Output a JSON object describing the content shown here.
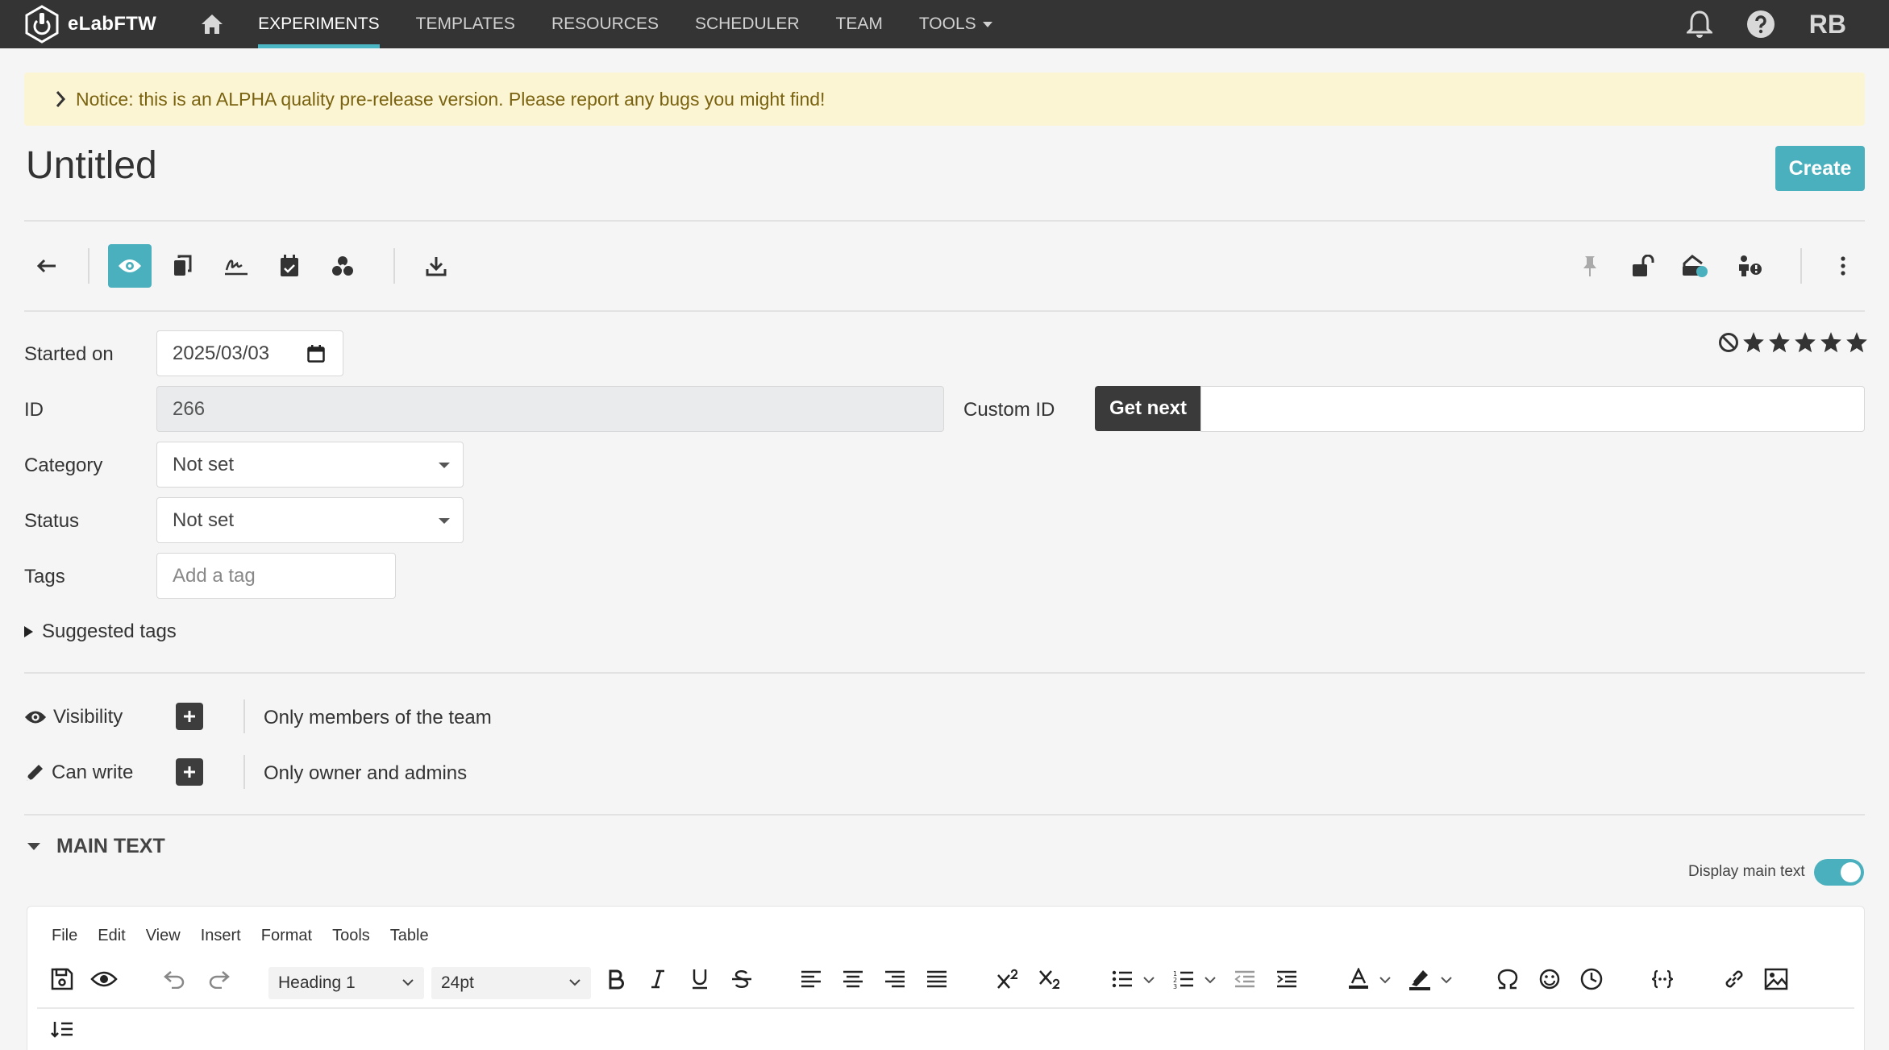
{
  "app": {
    "brand": "eLabFTW",
    "nav": [
      "EXPERIMENTS",
      "TEMPLATES",
      "RESOURCES",
      "SCHEDULER",
      "TEAM",
      "TOOLS"
    ],
    "active_nav": "EXPERIMENTS",
    "user_initials": "RB",
    "accent": "#4bb0bd",
    "navbar_color": "#343434"
  },
  "notice": {
    "text": "Notice: this is an ALPHA quality pre-release version. Please report any bugs you might find!",
    "bg": "#fcf5d3"
  },
  "page": {
    "title": "Untitled",
    "create_label": "Create"
  },
  "toolbar": {
    "left_icons": [
      "back-arrow-icon",
      "eye-icon",
      "duplicate-icon",
      "sign-icon",
      "calendar-icon",
      "linked-icon",
      "download-icon"
    ],
    "right_icons": [
      "pin-icon",
      "unlock-icon",
      "timestamp-icon",
      "transfer-owner-icon",
      "more-vertical-icon"
    ],
    "active": "eye-icon"
  },
  "form": {
    "started_on_label": "Started on",
    "started_on_value": "2025/03/03",
    "id_label": "ID",
    "id_value": "266",
    "custom_id_label": "Custom ID",
    "get_next_label": "Get next",
    "custom_id_value": "",
    "category_label": "Category",
    "category_value": "Not set",
    "status_label": "Status",
    "status_value": "Not set",
    "tags_label": "Tags",
    "tags_placeholder": "Add a tag",
    "suggested_tags_label": "Suggested tags",
    "rating": 0,
    "rating_max": 5
  },
  "permissions": {
    "visibility_label": "Visibility",
    "visibility_value": "Only members of the team",
    "canwrite_label": "Can write",
    "canwrite_value": "Only owner and admins"
  },
  "main_text": {
    "section_label": "MAIN TEXT",
    "toggle_label": "Display main text",
    "toggle_on": true
  },
  "editor": {
    "menus": [
      "File",
      "Edit",
      "View",
      "Insert",
      "Format",
      "Tools",
      "Table"
    ],
    "block_format": "Heading 1",
    "font_size": "24pt"
  }
}
